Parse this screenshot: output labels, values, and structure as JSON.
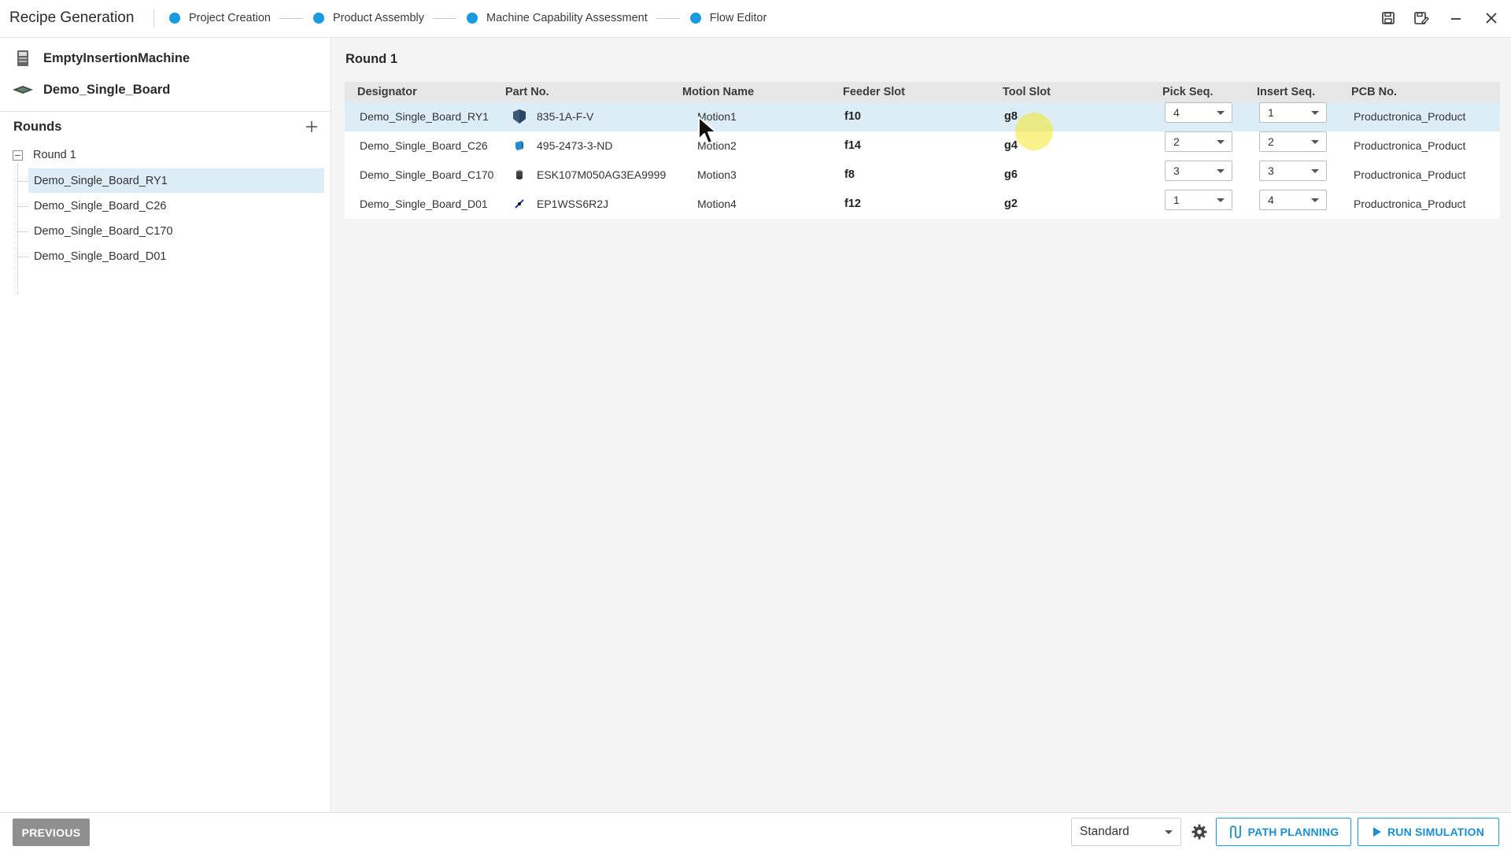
{
  "app": {
    "title": "Recipe Generation"
  },
  "steps": [
    {
      "label": "Project Creation"
    },
    {
      "label": "Product Assembly"
    },
    {
      "label": "Machine Capability Assessment"
    },
    {
      "label": "Flow Editor"
    }
  ],
  "colors": {
    "accent": "#1a9be0",
    "selection": "#dcedf8",
    "header_bg": "#e6e6e6",
    "main_bg": "#f4f4f4",
    "previous_button": "#8f8f8f"
  },
  "sidebar": {
    "machine": {
      "label": "EmptyInsertionMachine",
      "icon": "machine-icon"
    },
    "board": {
      "label": "Demo_Single_Board",
      "icon": "board-icon"
    },
    "rounds_header": "Rounds",
    "round": {
      "label": "Round 1",
      "expanded": true
    },
    "items": [
      {
        "label": "Demo_Single_Board_RY1",
        "selected": true
      },
      {
        "label": "Demo_Single_Board_C26",
        "selected": false
      },
      {
        "label": "Demo_Single_Board_C170",
        "selected": false
      },
      {
        "label": "Demo_Single_Board_D01",
        "selected": false
      }
    ]
  },
  "main": {
    "round_title": "Round 1",
    "columns": [
      "Designator",
      "Part No.",
      "Motion Name",
      "Feeder Slot",
      "Tool Slot",
      "Pick Seq.",
      "Insert Seq.",
      "PCB No."
    ],
    "rows": [
      {
        "designator": "Demo_Single_Board_RY1",
        "part_no": "835-1A-F-V",
        "part_icon": "relay-part-icon",
        "motion": "Motion1",
        "feeder": "f10",
        "tool": "g8",
        "pick_seq": "4",
        "insert_seq": "1",
        "pcb": "Productronica_Product",
        "selected": true
      },
      {
        "designator": "Demo_Single_Board_C26",
        "part_no": "495-2473-3-ND",
        "part_icon": "capacitor-part-icon",
        "motion": "Motion2",
        "feeder": "f14",
        "tool": "g4",
        "pick_seq": "2",
        "insert_seq": "2",
        "pcb": "Productronica_Product",
        "selected": false
      },
      {
        "designator": "Demo_Single_Board_C170",
        "part_no": "ESK107M050AG3EA9999",
        "part_icon": "electrolytic-part-icon",
        "motion": "Motion3",
        "feeder": "f8",
        "tool": "g6",
        "pick_seq": "3",
        "insert_seq": "3",
        "pcb": "Productronica_Product",
        "selected": false
      },
      {
        "designator": "Demo_Single_Board_D01",
        "part_no": "EP1WSS6R2J",
        "part_icon": "diode-part-icon",
        "motion": "Motion4",
        "feeder": "f12",
        "tool": "g2",
        "pick_seq": "1",
        "insert_seq": "4",
        "pcb": "Productronica_Product",
        "selected": false
      }
    ]
  },
  "bottom": {
    "previous_label": "PREVIOUS",
    "mode_value": "Standard",
    "path_planning_label": "PATH PLANNING",
    "run_simulation_label": "RUN SIMULATION"
  }
}
